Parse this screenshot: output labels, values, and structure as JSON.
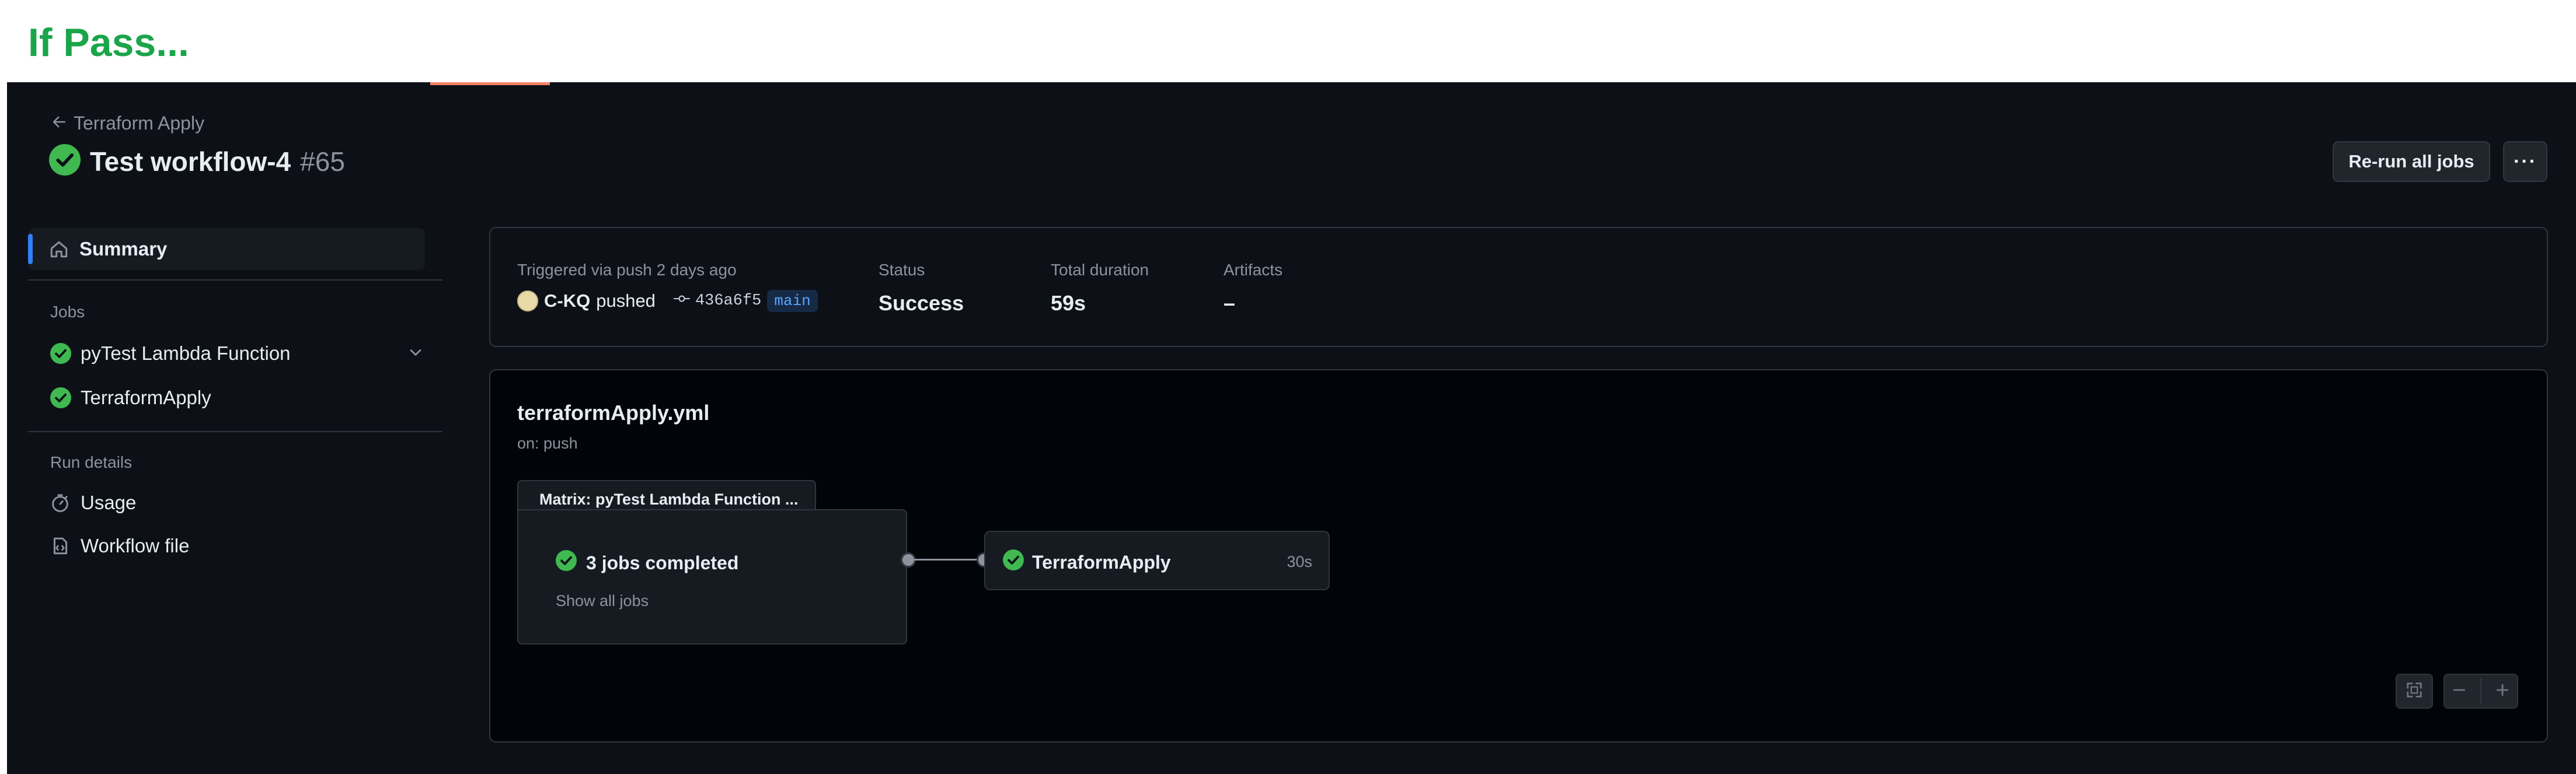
{
  "banner": {
    "title": "If Pass..."
  },
  "header": {
    "back_label": "Terraform Apply",
    "title": "Test workflow-4",
    "run_number": "#65",
    "rerun_label": "Re-run all jobs",
    "more_label": "···"
  },
  "sidebar": {
    "summary_label": "Summary",
    "jobs_heading": "Jobs",
    "jobs": [
      {
        "label": "pyTest Lambda Function",
        "status": "success"
      },
      {
        "label": "TerraformApply",
        "status": "success"
      }
    ],
    "run_details_heading": "Run details",
    "usage_label": "Usage",
    "workflow_file_label": "Workflow file"
  },
  "summary": {
    "trigger_text": "Triggered via push 2 days ago",
    "user": "C-KQ",
    "action": "pushed",
    "commit": "436a6f5",
    "branch": "main",
    "status_label": "Status",
    "status_value": "Success",
    "duration_label": "Total duration",
    "duration_value": "59s",
    "artifacts_label": "Artifacts",
    "artifacts_value": "–"
  },
  "graph": {
    "workflow_file": "terraformApply.yml",
    "trigger": "on: push",
    "matrix_title": "Matrix: pyTest Lambda Function ...",
    "matrix_status": "3 jobs completed",
    "show_all": "Show all jobs",
    "job_name": "TerraformApply",
    "job_duration": "30s"
  },
  "colors": {
    "success": "#3fb950",
    "accent": "#2f81f7",
    "banner_green": "#1aa54a"
  }
}
